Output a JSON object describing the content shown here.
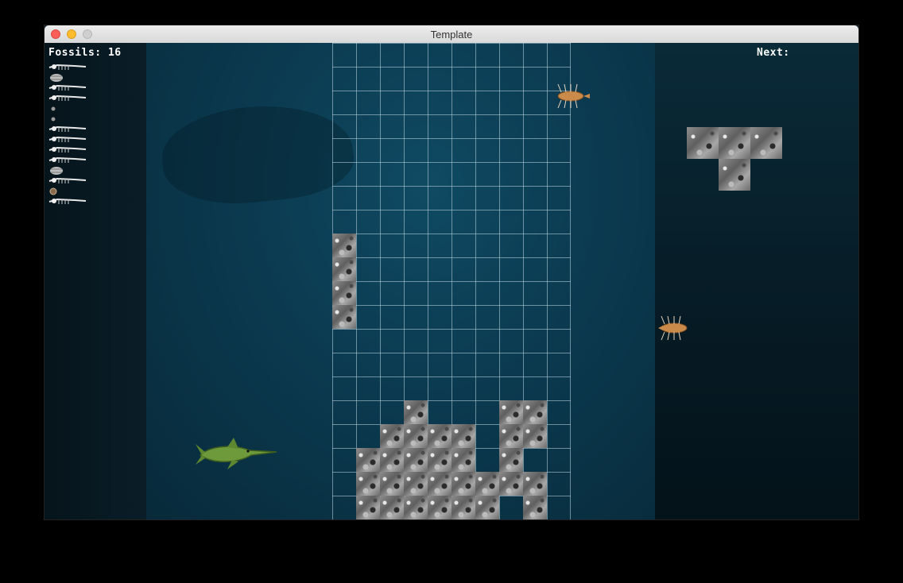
{
  "window": {
    "title": "Template"
  },
  "hud": {
    "fossils_label": "Fossils: 16",
    "next_label": "Next:"
  },
  "fossil_collection": {
    "icons": [
      "ichthyosaur-skeleton-icon",
      "trilobite-icon",
      "ichthyosaur-skeleton-icon",
      "ichthyosaur-skeleton-icon",
      "small-fossil-icon",
      "small-fossil-icon",
      "ichthyosaur-skeleton-icon",
      "ichthyosaur-skeleton-icon",
      "ichthyosaur-skeleton-icon",
      "ichthyosaur-skeleton-icon",
      "trilobite-icon",
      "ichthyosaur-skeleton-icon",
      "ammonite-icon",
      "ichthyosaur-skeleton-icon"
    ]
  },
  "board": {
    "columns": 10,
    "rows": 20,
    "filled_cells": [
      [
        0,
        8
      ],
      [
        0,
        9
      ],
      [
        0,
        10
      ],
      [
        0,
        11
      ],
      [
        3,
        15
      ],
      [
        7,
        15
      ],
      [
        8,
        15
      ],
      [
        2,
        16
      ],
      [
        3,
        16
      ],
      [
        4,
        16
      ],
      [
        5,
        16
      ],
      [
        7,
        16
      ],
      [
        8,
        16
      ],
      [
        1,
        17
      ],
      [
        2,
        17
      ],
      [
        3,
        17
      ],
      [
        4,
        17
      ],
      [
        5,
        17
      ],
      [
        7,
        17
      ],
      [
        1,
        18
      ],
      [
        2,
        18
      ],
      [
        3,
        18
      ],
      [
        4,
        18
      ],
      [
        5,
        18
      ],
      [
        6,
        18
      ],
      [
        7,
        18
      ],
      [
        8,
        18
      ],
      [
        1,
        19
      ],
      [
        2,
        19
      ],
      [
        3,
        19
      ],
      [
        4,
        19
      ],
      [
        5,
        19
      ],
      [
        6,
        19
      ],
      [
        8,
        19
      ]
    ]
  },
  "next_piece": {
    "shape": "T",
    "cells": [
      [
        0,
        0
      ],
      [
        1,
        0
      ],
      [
        2,
        0
      ],
      [
        1,
        1
      ]
    ]
  },
  "colors": {
    "water": "#0b3a50",
    "grid_line": "#bed7e1",
    "text": "#ffffff"
  }
}
